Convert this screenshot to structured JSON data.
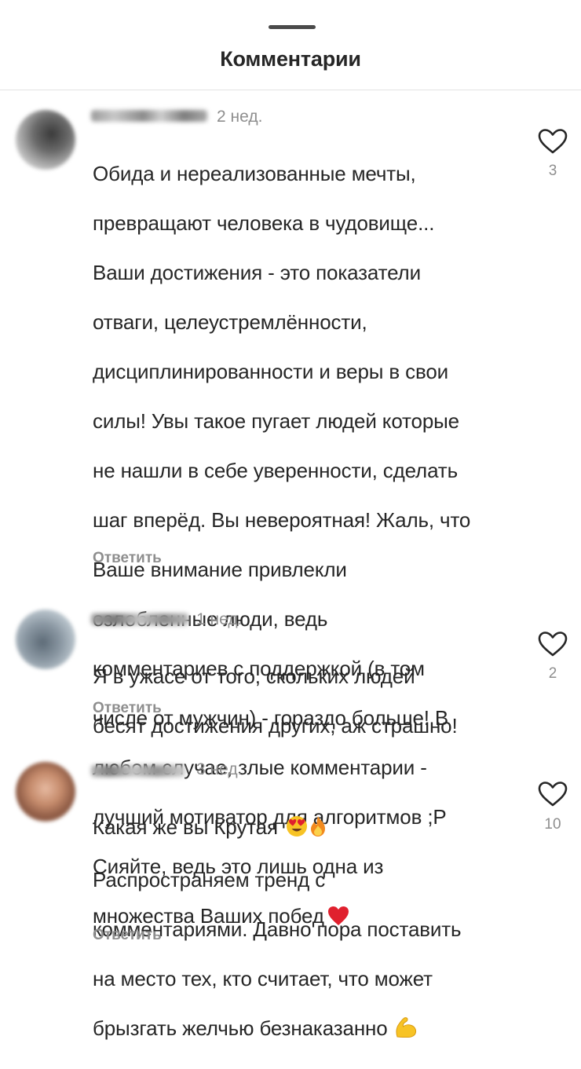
{
  "header": {
    "title": "Комментарии"
  },
  "comments": [
    {
      "time": "2 нед.",
      "lines": [
        "Обида и нереализованные мечты,",
        "превращают человека в чудовище...",
        "Ваши достижения - это показатели",
        "отваги, целеустремлённости,",
        "дисциплинированности и веры в свои",
        "силы! Увы такое пугает людей которые",
        "не нашли в себе уверенности, сделать",
        "шаг вперёд. Вы невероятная! Жаль, что",
        "Ваше внимание привлекли",
        "озлобленные люди, ведь",
        "комментариев с поддержкой (в том",
        "числе от мужчин) - гораздо больше! В",
        "любом случае, злые комментарии -",
        "лучший мотиватор для алгоритмов ;P",
        "Сияйте, ведь это лишь одна из",
        "множества Ваших побед"
      ],
      "emoji": [
        "red-heart-emoji"
      ],
      "reply_label": "Ответить",
      "like_count": "3",
      "like_icon": "heart-outline-icon"
    },
    {
      "time": "1 нед.",
      "lines": [
        "Я в ужасе от того, скольких людей",
        "бесят достижения других, аж страшно!"
      ],
      "reply_label": "Ответить",
      "like_count": "2",
      "like_icon": "heart-outline-icon"
    },
    {
      "time": "3 нед.",
      "lines_first": "Какая же вы Крутая",
      "lines": [
        "Распространяем тренд с",
        "комментариями. Давно пора поставить",
        "на место тех, кто считает, что может",
        "брызгать желчью безнаказанно"
      ],
      "emoji": [
        "heart-eyes-emoji",
        "fire-emoji",
        "flexed-biceps-emoji"
      ],
      "reply_label": "Ответить",
      "like_count": "10",
      "like_icon": "heart-outline-icon"
    }
  ],
  "colors": {
    "text": "#262626",
    "secondary": "#8e8e8e",
    "heart_red": "#e0202e"
  }
}
